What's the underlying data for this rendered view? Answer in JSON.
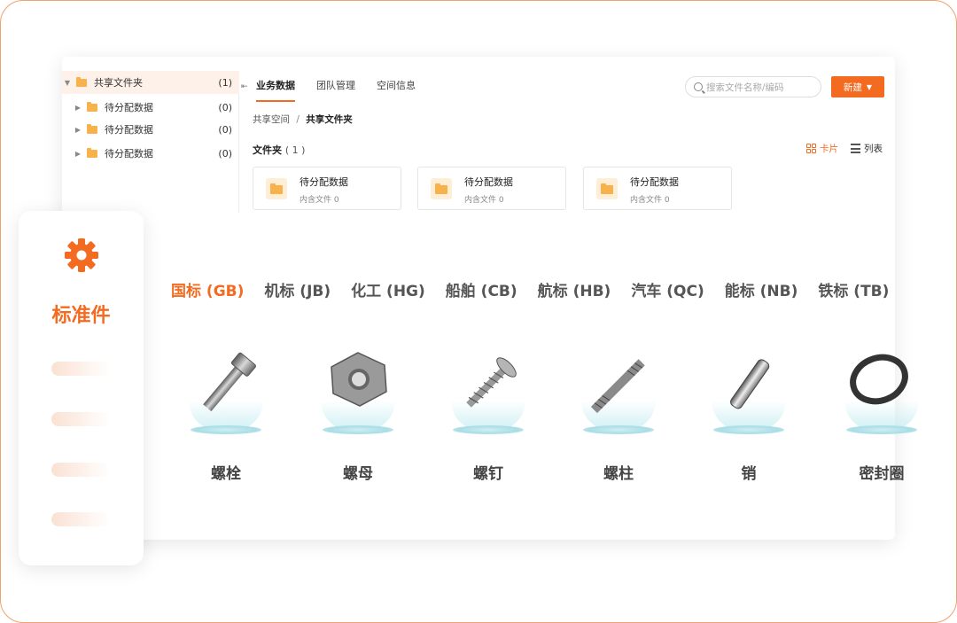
{
  "tree": {
    "root": {
      "label": "共享文件夹",
      "count": "(1)"
    },
    "children": [
      {
        "label": "待分配数据",
        "count": "(0)"
      },
      {
        "label": "待分配数据",
        "count": "(0)"
      },
      {
        "label": "待分配数据",
        "count": "(0)"
      }
    ]
  },
  "tabs": [
    "业务数据",
    "团队管理",
    "空间信息"
  ],
  "search": {
    "placeholder": "搜索文件名称/编码"
  },
  "new_button": {
    "label": "新建"
  },
  "breadcrumb": {
    "parent": "共享空间",
    "separator": "/",
    "current": "共享文件夹"
  },
  "folder_section": {
    "title": "文件夹",
    "count": "( 1 )"
  },
  "view_modes": {
    "card": "卡片",
    "list": "列表"
  },
  "cards": [
    {
      "name": "待分配数据",
      "sub": "内含文件 0"
    },
    {
      "name": "待分配数据",
      "sub": "内含文件 0"
    },
    {
      "name": "待分配数据",
      "sub": "内含文件 0"
    }
  ],
  "side_panel": {
    "title": "标准件",
    "icon": "gear-icon",
    "accent": "#f36b21"
  },
  "standards": [
    "国标 (GB)",
    "机标 (JB)",
    "化工 (HG)",
    "船舶 (CB)",
    "航标 (HB)",
    "汽车 (QC)",
    "能标 (NB)",
    "铁标 (TB)"
  ],
  "parts": [
    {
      "name": "螺栓",
      "icon": "bolt-icon"
    },
    {
      "name": "螺母",
      "icon": "nut-icon"
    },
    {
      "name": "螺钉",
      "icon": "screw-icon"
    },
    {
      "name": "螺柱",
      "icon": "stud-icon"
    },
    {
      "name": "销",
      "icon": "pin-icon"
    },
    {
      "name": "密封圈",
      "icon": "seal-ring-icon"
    }
  ]
}
